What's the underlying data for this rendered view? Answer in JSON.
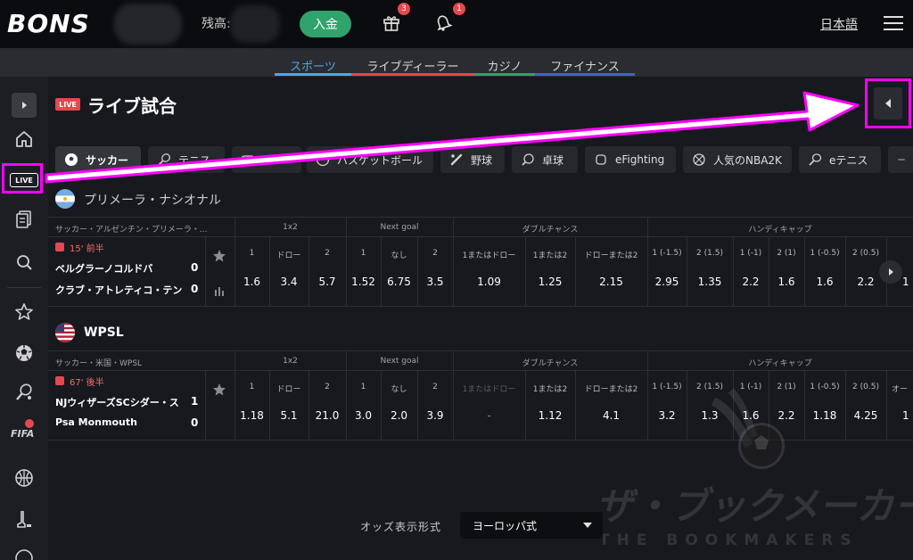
{
  "topbar": {
    "logo": "BONS",
    "balance_label": "残高:",
    "deposit_label": "入金",
    "gift_badge": "3",
    "bell_badge": "1",
    "language": "日本語"
  },
  "nav": {
    "tabs": [
      {
        "label": "スポーツ",
        "color": "#4aa8e8"
      },
      {
        "label": "ライブディーラー",
        "color": "#e5484d"
      },
      {
        "label": "カジノ",
        "color": "#2fa36b"
      },
      {
        "label": "ファイナンス",
        "color": "#3f63c8"
      }
    ]
  },
  "sidebar": {
    "live_label": "LIVE"
  },
  "header": {
    "live_tag": "LIVE",
    "title": "ライブ試合"
  },
  "sports": [
    {
      "label": "サッカー",
      "icon": "soccer-ball-icon"
    },
    {
      "label": "テニス",
      "icon": "tennis-icon"
    },
    {
      "label": "バスケットボール",
      "icon": "basketball-icon"
    },
    {
      "label": "野球",
      "icon": "baseball-icon"
    },
    {
      "label": "卓球",
      "icon": "table-tennis-icon"
    },
    {
      "label": "eFighting",
      "icon": "efighting-icon"
    },
    {
      "label": "人気のNBA2K",
      "icon": "nba2k-icon"
    },
    {
      "label": "eテニス",
      "icon": "etennis-icon"
    }
  ],
  "leagues": [
    {
      "name": "プリメーラ・ナシオナル",
      "breadcrumb": "サッカー・アルゼンチン・プリメーラ・...",
      "markets": [
        "1x2",
        "Next goal",
        "ダブルチャンス",
        "ハンディキャップ"
      ],
      "selections": [
        "1",
        "ドロー",
        "2",
        "1",
        "なし",
        "2",
        "1またはドロー",
        "1または2",
        "ドローまたは2",
        "1 (-1.5)",
        "2 (1.5)",
        "1 (-1)",
        "2 (1)",
        "1 (-0.5)",
        "2 (0.5)"
      ],
      "odds": [
        "1.6",
        "3.4",
        "5.7",
        "1.52",
        "6.75",
        "3.5",
        "1.09",
        "1.25",
        "2.15",
        "2.95",
        "1.35",
        "2.2",
        "1.6",
        "1.6",
        "2.2"
      ],
      "overflow_odds": "1",
      "time": "15' 前半",
      "home": "ベルグラーノコルドバ",
      "away": "クラブ・アトレティコ・テン",
      "home_score": "0",
      "away_score": "0"
    },
    {
      "name": "WPSL",
      "breadcrumb": "サッカー・米国・WPSL",
      "markets": [
        "1x2",
        "Next goal",
        "ダブルチャンス",
        "ハンディキャップ"
      ],
      "selections": [
        "1",
        "ドロー",
        "2",
        "1",
        "なし",
        "2",
        "1またはドロー",
        "1または2",
        "ドローまたは2",
        "1 (-1.5)",
        "2 (1.5)",
        "1 (-1)",
        "2 (1)",
        "1 (-0.5)",
        "2 (0.5)"
      ],
      "overflow_selection": "オー",
      "odds": [
        "1.18",
        "5.1",
        "21.0",
        "3.0",
        "2.0",
        "3.9",
        "-",
        "1.12",
        "4.1",
        "3.2",
        "1.3",
        "1.6",
        "2.2",
        "1.18",
        "4.25"
      ],
      "overflow_odds": "1",
      "time": "67' 後半",
      "home": "NJウィザーズSCシダー・ス",
      "away": "Psa Monmouth",
      "home_score": "1",
      "away_score": "0"
    }
  ],
  "odds_format": {
    "label": "オッズ表示形式",
    "value": "ヨーロッパ式"
  },
  "watermark": {
    "title": "ザ・ブックメーカーズ",
    "subtitle": "THE BOOKMAKERS"
  }
}
